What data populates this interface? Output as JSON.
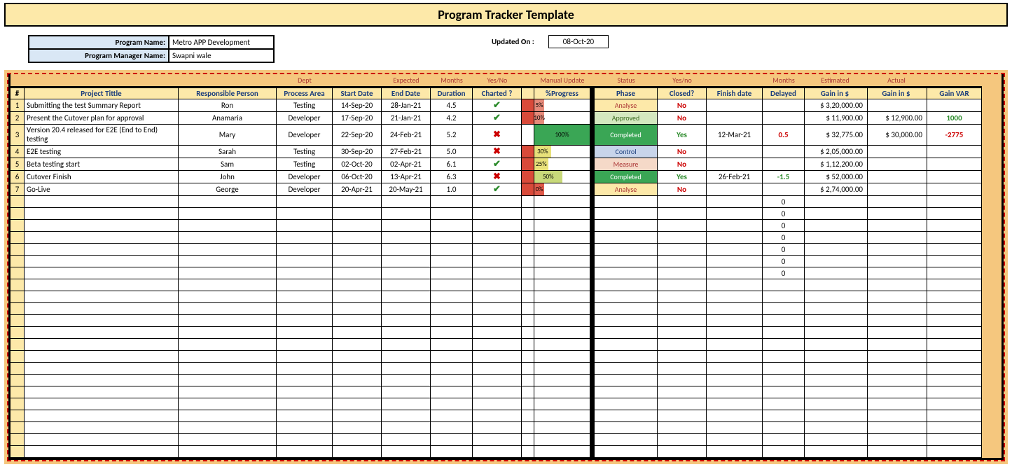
{
  "title": "Program Tracker Template",
  "meta": {
    "program_name_label": "Program Name:",
    "program_name": "Metro APP Development",
    "manager_name_label": "Program Manager Name:",
    "manager_name": "Swapni wale",
    "updated_label": "Updated On :",
    "updated_on": "08-Oct-20"
  },
  "sub_headers": {
    "dept": "Dept",
    "expected": "Expected",
    "months": "Months",
    "yesno": "Yes/No",
    "manual": "Manual Update",
    "status": "Status",
    "yesno2": "Yes/no",
    "estimated": "Estimated",
    "actual": "Actual"
  },
  "headers": {
    "num": "#",
    "title": "Project Tittle",
    "person": "Responsible Person",
    "area": "Process Area",
    "start": "Start Date",
    "end": "End Date",
    "duration": "Duration",
    "charted": "Charted ?",
    "progress": "%Progress",
    "phase": "Phase",
    "closed": "Closed?",
    "finish": "Finish date",
    "delayed": "Delayed",
    "gain1": "Gain in $",
    "gain2": "Gain in $",
    "var": "Gain VAR"
  },
  "phase_styles": {
    "Analyse": "analyse",
    "Approved": "approved",
    "Completed": "completed",
    "Control": "control",
    "Measure": "measure"
  },
  "rows": [
    {
      "num": "1",
      "title": "Submitting the test Summary Report",
      "person": "Ron",
      "area": "Testing",
      "start": "14-Sep-20",
      "end": "28-Jan-21",
      "duration": "4.5",
      "charted": "yes",
      "flag": "red",
      "progress": 5,
      "prog_text": "5%",
      "prog_color": "#e68a7a",
      "phase": "Analyse",
      "closed": "No",
      "finish": "",
      "delayed": "",
      "gain1": "$  3,20,000.00",
      "gain2": "",
      "var": ""
    },
    {
      "num": "2",
      "title": "Present the Cutover plan for approval",
      "person": "Anamaria",
      "area": "Developer",
      "start": "17-Sep-20",
      "end": "21-Jan-21",
      "duration": "4.2",
      "charted": "yes",
      "flag": "red",
      "progress": 10,
      "prog_text": "10%",
      "prog_color": "#e68a7a",
      "phase": "Approved",
      "closed": "No",
      "finish": "",
      "delayed": "",
      "gain1": "$     11,900.00",
      "gain2": "$  12,900.00",
      "var": "1000",
      "var_color": "green"
    },
    {
      "num": "3",
      "title": "Version 20.4 released for E2E (End to End) testing",
      "person": "Mary",
      "area": "Developer",
      "start": "22-Sep-20",
      "end": "24-Feb-21",
      "duration": "5.2",
      "charted": "no",
      "flag": "",
      "progress": 100,
      "prog_text": "100%",
      "prog_color": "#3aa655",
      "phase": "Completed",
      "closed": "Yes",
      "finish": "12-Mar-21",
      "delayed": "0.5",
      "delay_color": "red",
      "gain1": "$     32,775.00",
      "gain2": "$  30,000.00",
      "var": "-2775",
      "var_color": "red",
      "tall": true
    },
    {
      "num": "4",
      "title": "E2E testing",
      "person": "Sarah",
      "area": "Testing",
      "start": "30-Sep-20",
      "end": "27-Feb-21",
      "duration": "5.0",
      "charted": "no",
      "flag": "red",
      "progress": 30,
      "prog_text": "30%",
      "prog_color": "#e8e17a",
      "phase": "Control",
      "closed": "No",
      "finish": "",
      "delayed": "",
      "gain1": "$  2,05,000.00",
      "gain2": "",
      "var": ""
    },
    {
      "num": "5",
      "title": "Beta testing start",
      "person": "Sam",
      "area": "Testing",
      "start": "02-Oct-20",
      "end": "02-Apr-21",
      "duration": "6.1",
      "charted": "yes",
      "flag": "red",
      "progress": 25,
      "prog_text": "25%",
      "prog_color": "#e8e17a",
      "phase": "Measure",
      "closed": "No",
      "finish": "",
      "delayed": "",
      "gain1": "$  1,12,200.00",
      "gain2": "",
      "var": ""
    },
    {
      "num": "6",
      "title": "Cutover Finish",
      "person": "John",
      "area": "Developer",
      "start": "06-Oct-20",
      "end": "13-Apr-21",
      "duration": "6.3",
      "charted": "no",
      "flag": "red",
      "progress": 50,
      "prog_text": "50%",
      "prog_color": "#c8d97a",
      "phase": "Completed",
      "closed": "Yes",
      "finish": "26-Feb-21",
      "delayed": "-1.5",
      "delay_color": "green",
      "gain1": "$     52,000.00",
      "gain2": "",
      "var": ""
    },
    {
      "num": "7",
      "title": "Go-Live",
      "person": "George",
      "area": "Developer",
      "start": "20-Apr-21",
      "end": "20-May-21",
      "duration": "1.0",
      "charted": "yes",
      "flag": "red",
      "progress": 0,
      "prog_text": "0%",
      "prog_color": "#e05a4a",
      "phase": "Analyse",
      "closed": "No",
      "finish": "",
      "delayed": "",
      "gain1": "$  2,74,000.00",
      "gain2": "",
      "var": ""
    }
  ],
  "empty_delayed": [
    "0",
    "0",
    "0",
    "0",
    "0",
    "0",
    "0"
  ],
  "empty_rows": 22
}
